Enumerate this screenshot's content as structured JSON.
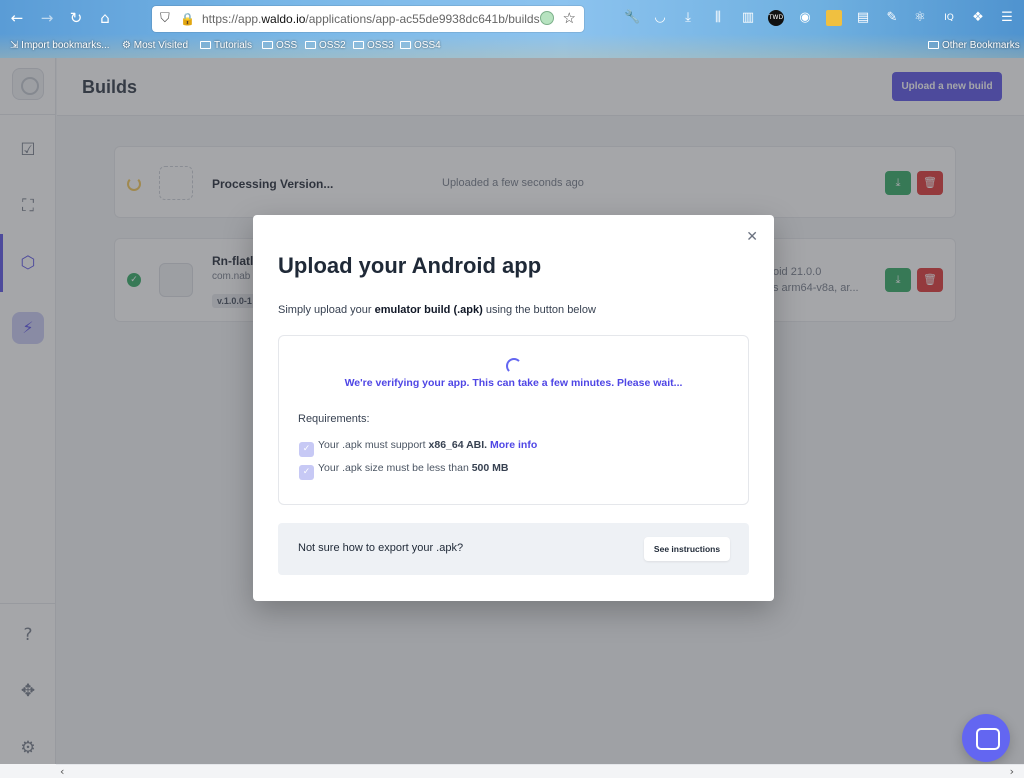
{
  "browser": {
    "url_prefix": "https://app.",
    "url_domain": "waldo.io",
    "url_path": "/applications/app-ac55de9938dc641b/builds",
    "bookmarks": [
      "Import bookmarks...",
      "Most Visited",
      "Tutorials",
      "OSS",
      "OSS2",
      "OSS3",
      "OSS4"
    ],
    "other_bookmarks": "Other Bookmarks"
  },
  "header": {
    "title": "Builds",
    "upload_button": "Upload a new build"
  },
  "builds": [
    {
      "name": "Processing Version...",
      "status": "processing",
      "uploaded": "Uploaded a few seconds ago"
    },
    {
      "name": "Rn-flatl",
      "package": "com.nab",
      "version": "v.1.0.0-1",
      "status": "ok",
      "meta_line1": "oid 21.0.0",
      "meta_line2": "s arm64-v8a, ar..."
    }
  ],
  "modal": {
    "title": "Upload your Android app",
    "desc_before": "Simply upload your ",
    "desc_bold": "emulator build (.apk)",
    "desc_after": " using the button below",
    "verifying_text": "We're verifying your app. This can take a few minutes. Please wait...",
    "requirements_label": "Requirements:",
    "req1_before": "Your .apk must support ",
    "req1_bold": "x86_64 ABI.",
    "req1_link": "More info",
    "req2_before": "Your .apk size must be less than ",
    "req2_bold": "500 MB",
    "help_text": "Not sure how to export your .apk?",
    "help_button": "See instructions"
  },
  "colors": {
    "accent": "#4f46e5",
    "success": "#22a559",
    "danger": "#dc2626"
  }
}
